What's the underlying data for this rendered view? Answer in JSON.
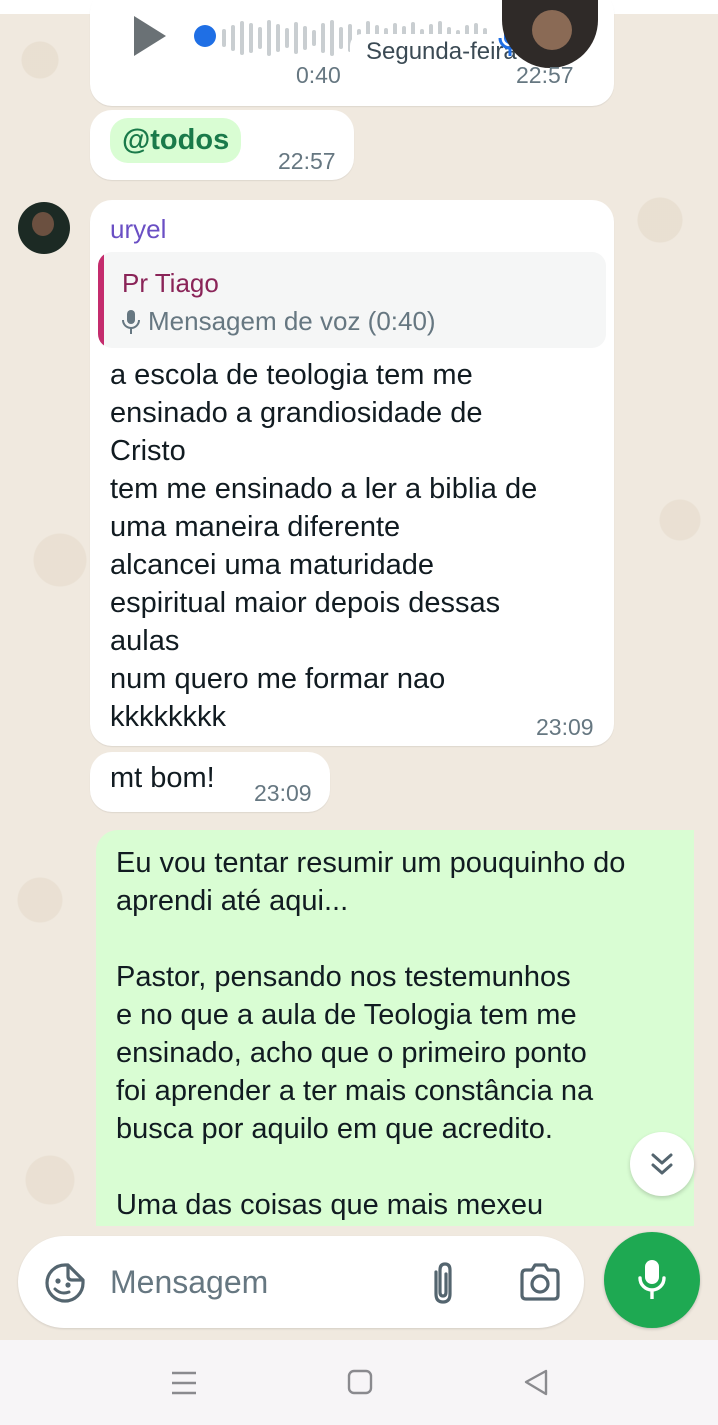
{
  "voice_message": {
    "duration": "0:40",
    "time": "22:57",
    "date_label": "Segunda-feira"
  },
  "mention_message": {
    "text": "@todos",
    "time": "22:57"
  },
  "group_message": {
    "sender": "uryel",
    "quote": {
      "author": "Pr Tiago",
      "text": "Mensagem de voz (0:40)",
      "icon": "mic-icon"
    },
    "body": "a escola de teologia tem me\nensinado a grandiosidade de\nCristo\ntem me ensinado a ler a biblia de\numa maneira diferente\nalcancei uma maturidade\nespiritual maior depois dessas\naulas\nnum quero me formar nao\nkkkkkkkk",
    "time": "23:09"
  },
  "short_message": {
    "text": "mt bom!",
    "time": "23:09"
  },
  "outgoing_message": {
    "body": "Eu vou tentar resumir um pouquinho do\naprendi até aqui...\n\nPastor, pensando nos testemunhos\ne no que a aula de Teologia tem me\nensinado, acho que o primeiro ponto\nfoi aprender a ter mais constância na\nbusca por aquilo em que acredito.\n\nUma das coisas que mais mexeu"
  },
  "composer": {
    "placeholder": "Mensagem"
  },
  "colors": {
    "accent": "#1ea952",
    "outgoing_bubble": "#d9fdd3",
    "sender_name": "#6a4fc4",
    "quote_bar": "#c42c6d"
  }
}
